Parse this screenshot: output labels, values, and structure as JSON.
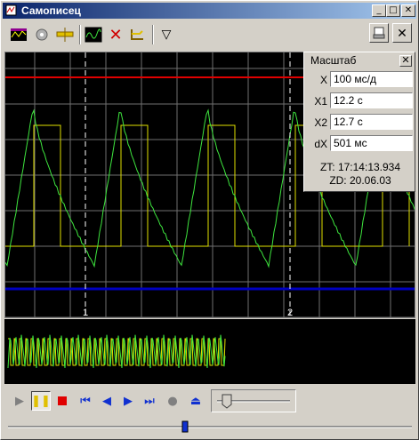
{
  "window": {
    "title": "Самописец"
  },
  "toolbar": {
    "icons": [
      "chart-icon",
      "gear-icon",
      "ruler-icon",
      "waveform-icon",
      "delete-icon",
      "probe-icon",
      "filter-icon"
    ]
  },
  "scale_panel": {
    "title": "Масштаб",
    "x_label": "X",
    "x_value": "100 мс/д",
    "x1_label": "X1",
    "x1_value": "12.2 с",
    "x2_label": "X2",
    "x2_value": "12.7 с",
    "dx_label": "dX",
    "dx_value": "501 мс",
    "zt": "ZT: 17:14:13.934",
    "zd": "ZD: 20.06.03"
  },
  "markers": {
    "m1": "1",
    "m2": "2"
  },
  "colors": {
    "grid": "#808080",
    "green": "#3ee63e",
    "yellow": "#e0e000",
    "red": "#e00000",
    "blue": "#0000c0"
  }
}
